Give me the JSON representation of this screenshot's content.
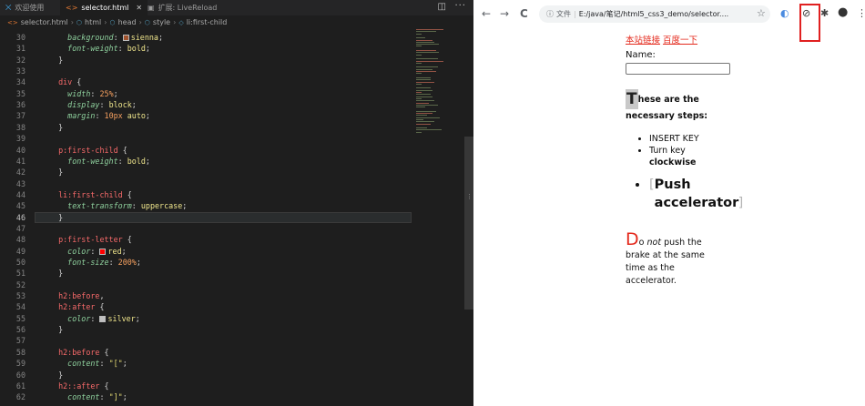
{
  "editor": {
    "tabs": [
      {
        "label": "欢迎使用",
        "icon": "vscode-icon",
        "active": false
      },
      {
        "label": "selector.html",
        "icon": "html-file-icon",
        "active": true
      },
      {
        "label": "扩展: LiveReload",
        "icon": "extensions-icon",
        "active": false
      }
    ],
    "breadcrumb": [
      "selector.html",
      "html",
      "head",
      "style",
      "li:first-child"
    ],
    "lines": [
      {
        "n": "30",
        "tokens": [
          [
            "p",
            "    "
          ],
          [
            "prop",
            "background"
          ],
          [
            "p",
            ": "
          ],
          [
            "swatch",
            "#a0522d"
          ],
          [
            "val",
            "sienna"
          ],
          [
            "p",
            ";"
          ]
        ]
      },
      {
        "n": "31",
        "tokens": [
          [
            "p",
            "    "
          ],
          [
            "prop",
            "font-weight"
          ],
          [
            "p",
            ": "
          ],
          [
            "val",
            "bold"
          ],
          [
            "p",
            ";"
          ]
        ]
      },
      {
        "n": "32",
        "tokens": [
          [
            "p",
            "  }"
          ]
        ]
      },
      {
        "n": "33",
        "tokens": []
      },
      {
        "n": "34",
        "tokens": [
          [
            "p",
            "  "
          ],
          [
            "sel",
            "div"
          ],
          [
            "p",
            " {"
          ]
        ]
      },
      {
        "n": "35",
        "tokens": [
          [
            "p",
            "    "
          ],
          [
            "prop",
            "width"
          ],
          [
            "p",
            ": "
          ],
          [
            "num",
            "25%"
          ],
          [
            "p",
            ";"
          ]
        ]
      },
      {
        "n": "36",
        "tokens": [
          [
            "p",
            "    "
          ],
          [
            "prop",
            "display"
          ],
          [
            "p",
            ": "
          ],
          [
            "val",
            "block"
          ],
          [
            "p",
            ";"
          ]
        ]
      },
      {
        "n": "37",
        "tokens": [
          [
            "p",
            "    "
          ],
          [
            "prop",
            "margin"
          ],
          [
            "p",
            ": "
          ],
          [
            "num",
            "10px"
          ],
          [
            "val",
            " auto"
          ],
          [
            "p",
            ";"
          ]
        ]
      },
      {
        "n": "38",
        "tokens": [
          [
            "p",
            "  }"
          ]
        ]
      },
      {
        "n": "39",
        "tokens": []
      },
      {
        "n": "40",
        "tokens": [
          [
            "p",
            "  "
          ],
          [
            "sel",
            "p:first-child"
          ],
          [
            "p",
            " {"
          ]
        ]
      },
      {
        "n": "41",
        "tokens": [
          [
            "p",
            "    "
          ],
          [
            "prop",
            "font-weight"
          ],
          [
            "p",
            ": "
          ],
          [
            "val",
            "bold"
          ],
          [
            "p",
            ";"
          ]
        ]
      },
      {
        "n": "42",
        "tokens": [
          [
            "p",
            "  }"
          ]
        ]
      },
      {
        "n": "43",
        "tokens": []
      },
      {
        "n": "44",
        "tokens": [
          [
            "p",
            "  "
          ],
          [
            "sel",
            "li:first-child"
          ],
          [
            "p",
            " {"
          ]
        ]
      },
      {
        "n": "45",
        "tokens": [
          [
            "p",
            "    "
          ],
          [
            "prop",
            "text-transform"
          ],
          [
            "p",
            ": "
          ],
          [
            "val",
            "uppercase"
          ],
          [
            "p",
            ";"
          ]
        ]
      },
      {
        "n": "46",
        "tokens": [
          [
            "p",
            "  }"
          ]
        ],
        "current": true
      },
      {
        "n": "47",
        "tokens": []
      },
      {
        "n": "48",
        "tokens": [
          [
            "p",
            "  "
          ],
          [
            "sel",
            "p:first-letter"
          ],
          [
            "p",
            " {"
          ]
        ]
      },
      {
        "n": "49",
        "tokens": [
          [
            "p",
            "    "
          ],
          [
            "prop",
            "color"
          ],
          [
            "p",
            ": "
          ],
          [
            "swatch",
            "#ff0000"
          ],
          [
            "val",
            "red"
          ],
          [
            "p",
            ";"
          ]
        ]
      },
      {
        "n": "50",
        "tokens": [
          [
            "p",
            "    "
          ],
          [
            "prop",
            "font-size"
          ],
          [
            "p",
            ": "
          ],
          [
            "num",
            "200%"
          ],
          [
            "p",
            ";"
          ]
        ]
      },
      {
        "n": "51",
        "tokens": [
          [
            "p",
            "  }"
          ]
        ]
      },
      {
        "n": "52",
        "tokens": []
      },
      {
        "n": "53",
        "tokens": [
          [
            "p",
            "  "
          ],
          [
            "sel",
            "h2:before"
          ],
          [
            "p",
            ","
          ]
        ]
      },
      {
        "n": "54",
        "tokens": [
          [
            "p",
            "  "
          ],
          [
            "sel",
            "h2:after"
          ],
          [
            "p",
            " {"
          ]
        ]
      },
      {
        "n": "55",
        "tokens": [
          [
            "p",
            "    "
          ],
          [
            "prop",
            "color"
          ],
          [
            "p",
            ": "
          ],
          [
            "swatch",
            "#c0c0c0"
          ],
          [
            "val",
            "silver"
          ],
          [
            "p",
            ";"
          ]
        ]
      },
      {
        "n": "56",
        "tokens": [
          [
            "p",
            "  }"
          ]
        ]
      },
      {
        "n": "57",
        "tokens": []
      },
      {
        "n": "58",
        "tokens": [
          [
            "p",
            "  "
          ],
          [
            "sel",
            "h2:before"
          ],
          [
            "p",
            " {"
          ]
        ]
      },
      {
        "n": "59",
        "tokens": [
          [
            "p",
            "    "
          ],
          [
            "prop",
            "content"
          ],
          [
            "p",
            ": "
          ],
          [
            "str",
            "\"[\""
          ],
          [
            "p",
            ";"
          ]
        ]
      },
      {
        "n": "60",
        "tokens": [
          [
            "p",
            "  }"
          ]
        ]
      },
      {
        "n": "61",
        "tokens": [
          [
            "p",
            "  "
          ],
          [
            "sel",
            "h2::after"
          ],
          [
            "p",
            " {"
          ]
        ]
      },
      {
        "n": "62",
        "tokens": [
          [
            "p",
            "    "
          ],
          [
            "prop",
            "content"
          ],
          [
            "p",
            ": "
          ],
          [
            "str",
            "\"]\""
          ],
          [
            "p",
            ";"
          ]
        ]
      }
    ]
  },
  "browser": {
    "nav": {
      "back": "←",
      "forward": "→",
      "reload": "C"
    },
    "omnibox": {
      "info_label": "文件",
      "url": "E:/java/笔记/html5_css3_demo/selector...."
    },
    "page": {
      "link1": "本站链接",
      "link2": "百度一下",
      "name_label": "Name:",
      "para1_first": "T",
      "para1_rest": "hese are the necessary steps:",
      "list_item1": "INSERT KEY",
      "list_item2_a": "Turn key",
      "list_item2_b": "clockwise",
      "big_open": "[",
      "big_text": "Push accelerator",
      "big_close": "]",
      "para2_first": "D",
      "para2_o": "o ",
      "para2_em": "not",
      "para2_rest": " push the brake at the same time as the accelerator."
    }
  },
  "colors": {
    "editor_bg": "#1e1e1e",
    "selector": "#f86a6a",
    "property": "#8fd19e",
    "value": "#f0e68c",
    "link_red": "#e42a1d",
    "highlight_box": "#e02020"
  }
}
